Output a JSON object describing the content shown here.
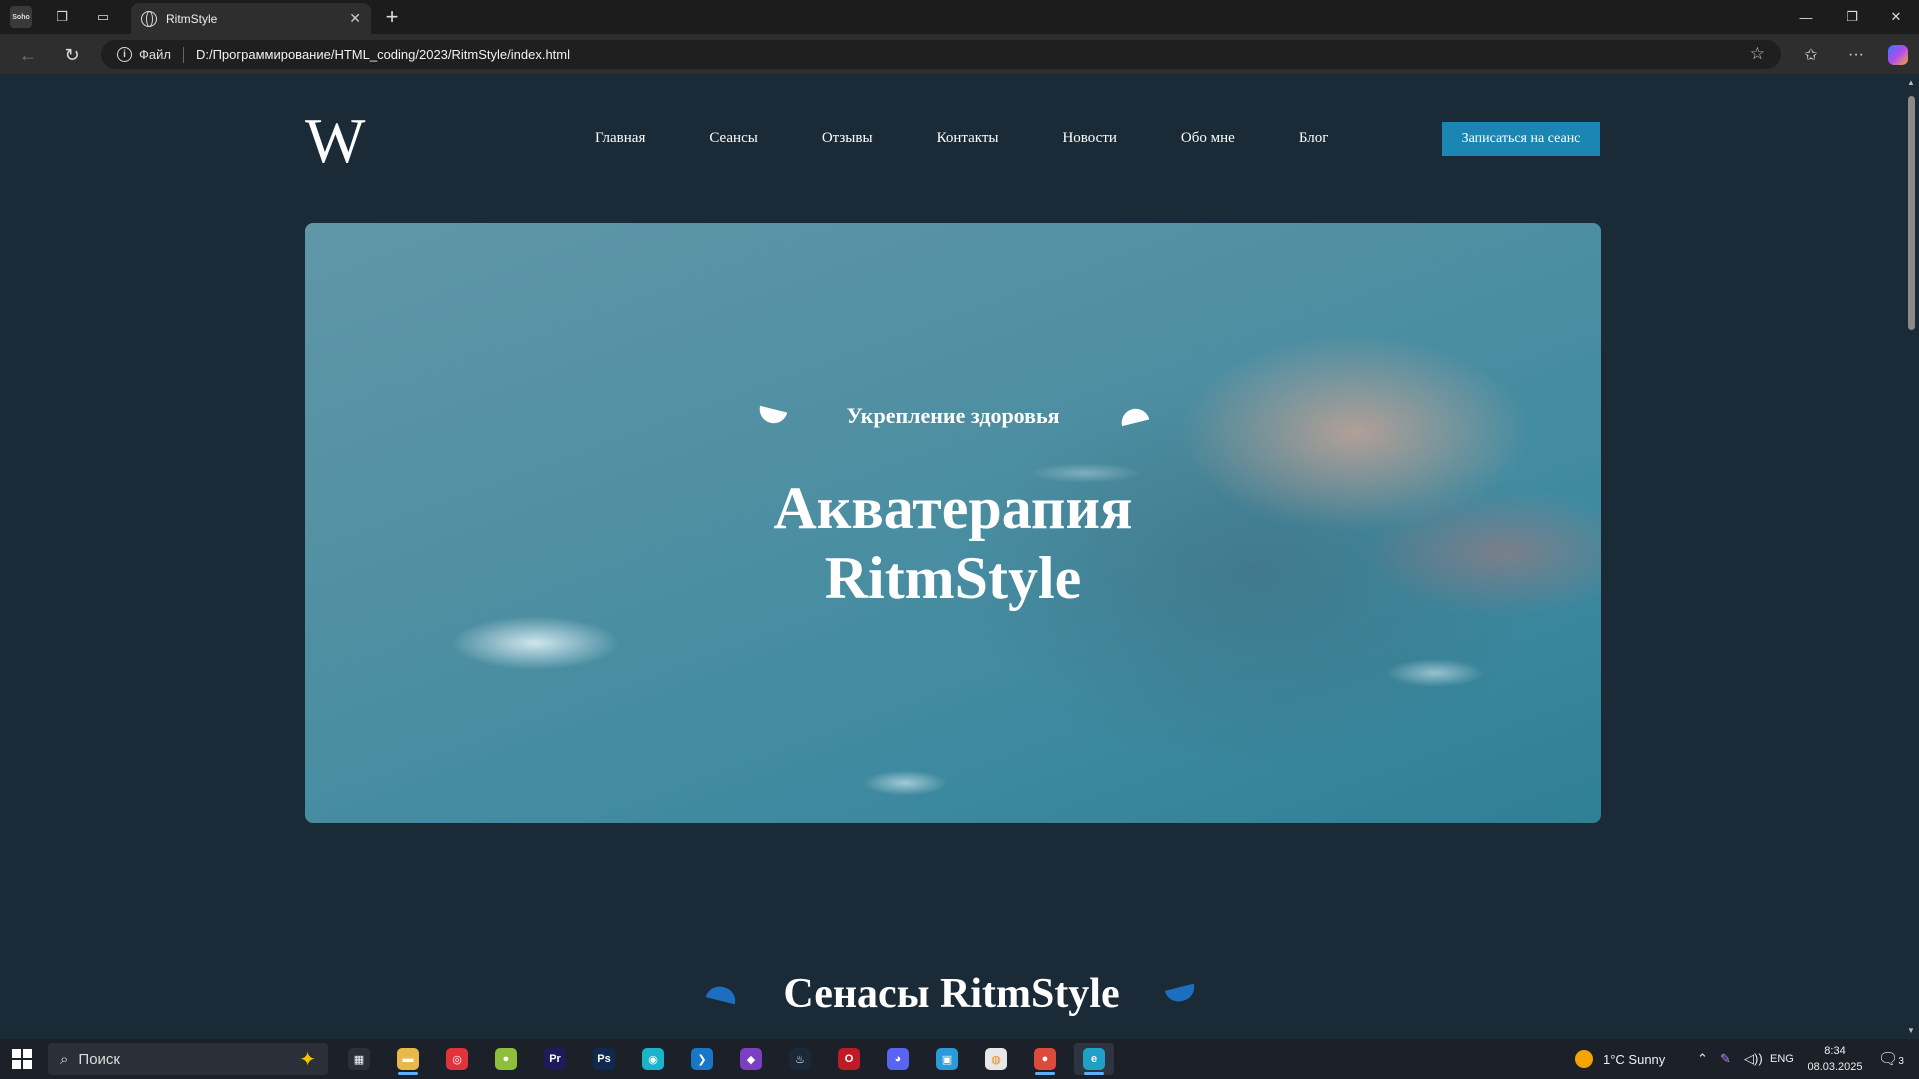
{
  "browser": {
    "tab_title": "RitmStyle",
    "tab_close": "✕",
    "new_tab": "+",
    "address_prefix": "Файл",
    "url": "D:/Программирование/HTML_coding/2023/RitmStyle/index.html",
    "window_controls": [
      "—",
      "❐",
      "✕"
    ]
  },
  "site": {
    "logo": "W",
    "nav": [
      "Главная",
      "Сеансы",
      "Отзывы",
      "Контакты",
      "Новости",
      "Обо мне",
      "Блог"
    ],
    "cta": "Записаться на сеанс",
    "hero": {
      "subtitle": "Укрепление здоровья",
      "title_line1": "Акватерапия",
      "title_line2": "RitmStyle"
    },
    "section_title": "Сенасы RitmStyle"
  },
  "taskbar": {
    "search_placeholder": "Поиск",
    "weather": "1°C  Sunny",
    "language": "ENG",
    "time": "8:34",
    "date": "08.03.2025",
    "notifications": "3",
    "apps": [
      {
        "name": "task-view",
        "label": "▦",
        "color": "#2a2f38"
      },
      {
        "name": "file-explorer",
        "label": "▬",
        "color": "#e8b84a"
      },
      {
        "name": "creative-cloud",
        "label": "◎",
        "color": "#e0343a"
      },
      {
        "name": "tennis-app",
        "label": "●",
        "color": "#8fbf3a"
      },
      {
        "name": "premiere-pro",
        "label": "Pr",
        "color": "#1f1a5a"
      },
      {
        "name": "photoshop",
        "label": "Ps",
        "color": "#0f2a4e"
      },
      {
        "name": "app-cyan",
        "label": "◉",
        "color": "#1bb3c9"
      },
      {
        "name": "vscode",
        "label": "❯",
        "color": "#1677c9"
      },
      {
        "name": "visual-studio",
        "label": "◆",
        "color": "#7a3fc2"
      },
      {
        "name": "steam",
        "label": "♨",
        "color": "#1b2838"
      },
      {
        "name": "opera",
        "label": "O",
        "color": "#c01a27"
      },
      {
        "name": "discord",
        "label": "◕",
        "color": "#5865f2"
      },
      {
        "name": "app-blue",
        "label": "▣",
        "color": "#2a9ad8"
      },
      {
        "name": "overwatch",
        "label": "◍",
        "color": "#e8e8e8"
      },
      {
        "name": "chrome",
        "label": "●",
        "color": "#dd4a3c"
      },
      {
        "name": "edge",
        "label": "e",
        "color": "#1ea0c8"
      }
    ]
  },
  "colors": {
    "page_bg": "#1a2a36",
    "cta_bg": "#1b86b4",
    "accent_leaf": "#1c6fc0"
  }
}
